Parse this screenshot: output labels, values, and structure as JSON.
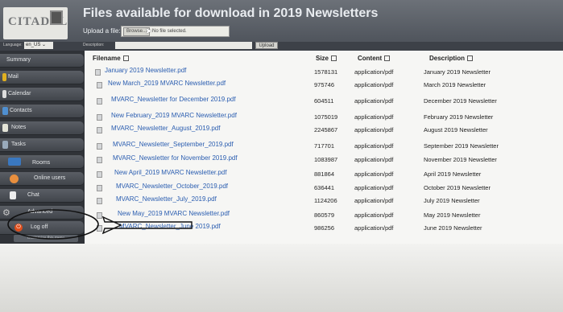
{
  "header": {
    "logo_text": "CITADEL",
    "title": "Files available for download in 2019 Newsletters",
    "upload_label": "Upload a file:",
    "browse_label": "Browse...",
    "no_file_text": "No file selected."
  },
  "strip": {
    "language_label": "Language:",
    "language_value": "en_US",
    "description_label": "Description:",
    "upload_button": "Upload"
  },
  "sidebar": {
    "items": [
      {
        "label": "Summary",
        "icon": "none"
      },
      {
        "label": "Mail",
        "icon": "mail-icon"
      },
      {
        "label": "Calendar",
        "icon": "calendar-icon"
      },
      {
        "label": "Contacts",
        "icon": "contacts-icon"
      },
      {
        "label": "Notes",
        "icon": "notes-icon"
      },
      {
        "label": "Tasks",
        "icon": "tasks-icon"
      },
      {
        "label": "Rooms",
        "icon": "rooms-icon"
      },
      {
        "label": "Online users",
        "icon": "users-icon"
      },
      {
        "label": "Chat",
        "icon": "chat-icon"
      },
      {
        "label": "Advanced",
        "icon": "gear-icon"
      },
      {
        "label": "Log off",
        "icon": "power-icon"
      }
    ],
    "customize": "Customize this menu"
  },
  "table": {
    "columns": [
      "Filename",
      "Size",
      "Content",
      "Description"
    ],
    "rows": [
      {
        "filename": "January 2019 Newsletter.pdf",
        "size": "1578131",
        "content": "application/pdf",
        "description": "January 2019 Newsletter"
      },
      {
        "filename": "New March_2019 MVARC Newsletter.pdf",
        "size": "975746",
        "content": "application/pdf",
        "description": "March 2019 Newsletter"
      },
      {
        "filename": "MVARC_Newsletter for December 2019.pdf",
        "size": "604511",
        "content": "application/pdf",
        "description": "December 2019 Newsletter"
      },
      {
        "filename": "New February_2019 MVARC Newsletter.pdf",
        "size": "1075019",
        "content": "application/pdf",
        "description": "February 2019 Newsletter"
      },
      {
        "filename": "MVARC_Newsletter_August_2019.pdf",
        "size": "2245867",
        "content": "application/pdf",
        "description": "August 2019 Newsletter"
      },
      {
        "filename": "MVARC_Newsletter_September_2019.pdf",
        "size": "717701",
        "content": "application/pdf",
        "description": "September 2019 Newsletter"
      },
      {
        "filename": "MVARC_Newsletter for November 2019.pdf",
        "size": "1083987",
        "content": "application/pdf",
        "description": "November 2019 Newsletter"
      },
      {
        "filename": "New April_2019 MVARC Newsletter.pdf",
        "size": "881864",
        "content": "application/pdf",
        "description": "April 2019 Newsletter"
      },
      {
        "filename": "MVARC_Newsletter_October_2019.pdf",
        "size": "636441",
        "content": "application/pdf",
        "description": "October 2019 Newsletter"
      },
      {
        "filename": "MVARC_Newsletter_July_2019.pdf",
        "size": "1124206",
        "content": "application/pdf",
        "description": "July 2019 Newsletter"
      },
      {
        "filename": "New May_2019 MVARC Newsletter.pdf",
        "size": "860579",
        "content": "application/pdf",
        "description": "May 2019 Newsletter"
      },
      {
        "filename": "MVARC_Newsletter_June 2019.pdf",
        "size": "986256",
        "content": "application/pdf",
        "description": "June 2019 Newsletter"
      }
    ]
  },
  "colors": {
    "header_bg": "#565b62",
    "sidebar_bg": "#303338",
    "link": "#2a5db0",
    "annotation": "#111111"
  }
}
